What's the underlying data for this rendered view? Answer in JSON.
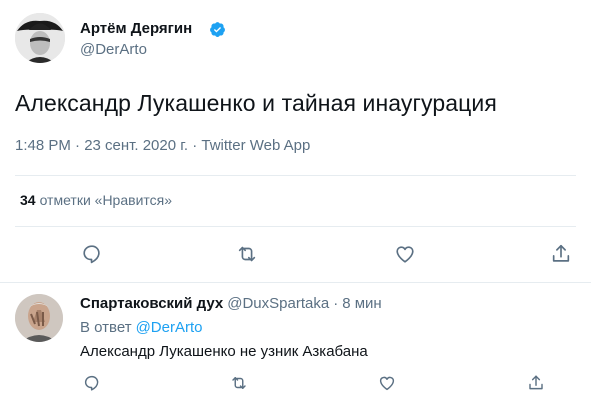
{
  "main_tweet": {
    "author": {
      "name": "Артём Дерягин",
      "handle": "@DerArto",
      "verified": true
    },
    "text": "Александр Лукашенко и тайная инаугурация",
    "meta": "1:48 PM · 23 сент. 2020 г. · Twitter Web App",
    "likes": {
      "count": "34",
      "label": "отметки «Нравится»"
    },
    "actions": [
      "reply-icon",
      "retweet-icon",
      "like-icon",
      "share-icon"
    ]
  },
  "reply_tweet": {
    "author": {
      "name": "Спартаковский дух",
      "handle": "@DuxSpartaka"
    },
    "separator": "·",
    "time": "8 мин",
    "reply_to_label": "В ответ",
    "reply_to_handle": "@DerArto",
    "text": "Александр Лукашенко не узник Азкабана",
    "actions": [
      "reply-icon",
      "retweet-icon",
      "like-icon",
      "share-icon"
    ]
  },
  "colors": {
    "accent": "#1da1f2",
    "secondary_text": "#5b7083",
    "primary_text": "#0f1419",
    "divider": "#e6ecf0"
  }
}
